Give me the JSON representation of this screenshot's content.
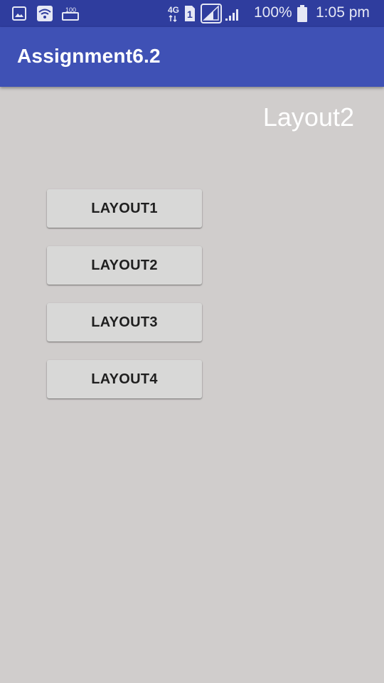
{
  "status_bar": {
    "icons": [
      "image-icon",
      "wifi-icon",
      "battery-100-icon",
      "4g-icon",
      "sim1-icon",
      "signal-sim1-icon",
      "signal-sim2-icon",
      "battery-icon"
    ],
    "network_label": "4G",
    "sim_label": "1",
    "small_battery_label": "100",
    "battery_percent": "100%",
    "time": "1:05 pm"
  },
  "app_bar": {
    "title": "Assignment6.2",
    "color": "#3f51b5"
  },
  "main": {
    "layout_label": "Layout2",
    "buttons": [
      {
        "label": "LAYOUT1"
      },
      {
        "label": "LAYOUT2"
      },
      {
        "label": "LAYOUT3"
      },
      {
        "label": "LAYOUT4"
      }
    ]
  },
  "colors": {
    "status_bar": "#2f3d9e",
    "app_bar": "#3f51b5",
    "background": "#d0cdcc",
    "button": "#d8d8d7"
  }
}
